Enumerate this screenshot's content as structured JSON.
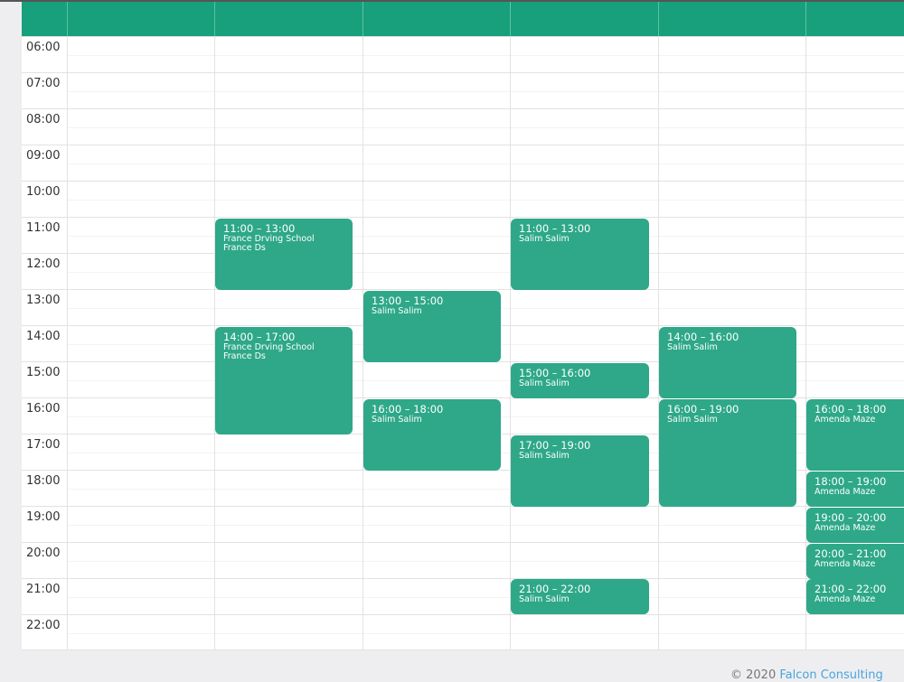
{
  "times": [
    "06:00",
    "07:00",
    "08:00",
    "09:00",
    "10:00",
    "11:00",
    "12:00",
    "13:00",
    "14:00",
    "15:00",
    "16:00",
    "17:00",
    "18:00",
    "19:00",
    "20:00",
    "21:00",
    "22:00"
  ],
  "events": [
    {
      "time": "11:00 – 13:00",
      "title": "France Drving School",
      "sub": "France Ds"
    },
    {
      "time": "14:00 – 17:00",
      "title": "France Drving School",
      "sub": "France Ds"
    },
    {
      "time": "13:00 – 15:00",
      "title": "Salim Salim"
    },
    {
      "time": "16:00 – 18:00",
      "title": "Salim Salim"
    },
    {
      "time": "11:00 – 13:00",
      "title": "Salim Salim"
    },
    {
      "time": "15:00 – 16:00",
      "title": "Salim Salim"
    },
    {
      "time": "17:00 – 19:00",
      "title": "Salim Salim"
    },
    {
      "time": "21:00 – 22:00",
      "title": "Salim Salim"
    },
    {
      "time": "14:00 – 16:00",
      "title": "Salim Salim"
    },
    {
      "time": "16:00 – 19:00",
      "title": "Salim Salim"
    },
    {
      "time": "16:00 – 18:00",
      "title": "Amenda Maze"
    },
    {
      "time": "18:00 – 19:00",
      "title": "Amenda Maze"
    },
    {
      "time": "19:00 – 20:00",
      "title": "Amenda Maze"
    },
    {
      "time": "20:00 – 21:00",
      "title": "Amenda Maze"
    },
    {
      "time": "21:00 – 22:00",
      "title": "Amenda Maze"
    }
  ],
  "footer": {
    "copyright": "© 2020 ",
    "link": "Falcon Consulting"
  }
}
